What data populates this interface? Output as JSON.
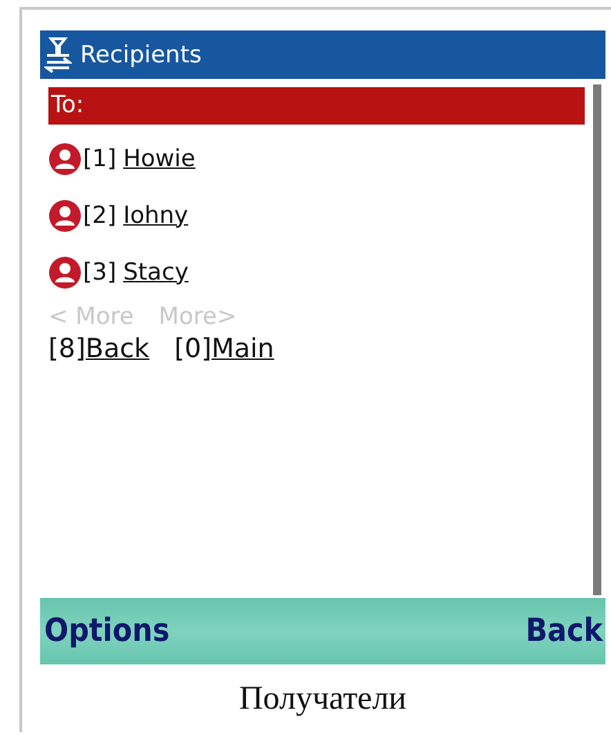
{
  "title": "Recipients",
  "to_label": "To:",
  "recipients": [
    {
      "number": "[1]",
      "name": "Howie"
    },
    {
      "number": "[2]",
      "name": "Iohny"
    },
    {
      "number": "[3]",
      "name": "Stacy"
    }
  ],
  "paging": [
    {
      "label": "< More",
      "disabled": true
    },
    {
      "label": "More>",
      "disabled": true
    }
  ],
  "nav": [
    {
      "key": "[8]",
      "label": "Back"
    },
    {
      "key": "[0]",
      "label": "Main"
    }
  ],
  "softkeys": {
    "left": "Options",
    "right": "Back"
  },
  "caption": "Получатели"
}
